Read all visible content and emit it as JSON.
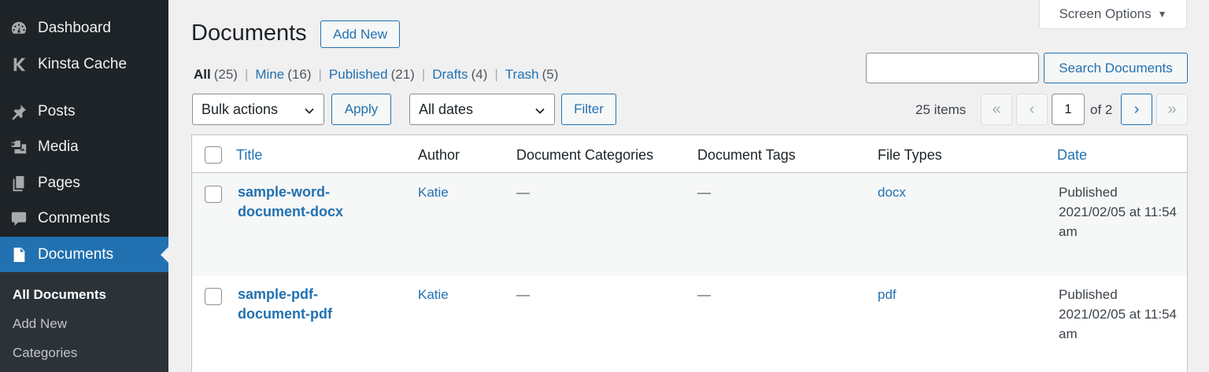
{
  "sidebar": {
    "items": [
      {
        "label": "Dashboard",
        "icon": "dashboard-icon"
      },
      {
        "label": "Kinsta Cache",
        "icon": "kinsta-icon"
      },
      {
        "label": "Posts",
        "icon": "pin-icon"
      },
      {
        "label": "Media",
        "icon": "media-icon"
      },
      {
        "label": "Pages",
        "icon": "pages-icon"
      },
      {
        "label": "Comments",
        "icon": "comments-icon"
      },
      {
        "label": "Documents",
        "icon": "document-icon"
      }
    ],
    "submenu": [
      "All Documents",
      "Add New",
      "Categories"
    ]
  },
  "header": {
    "title": "Documents",
    "add_new": "Add New",
    "screen_options": "Screen Options"
  },
  "filters": {
    "all": {
      "label": "All",
      "count": "(25)"
    },
    "mine": {
      "label": "Mine",
      "count": "(16)"
    },
    "published": {
      "label": "Published",
      "count": "(21)"
    },
    "drafts": {
      "label": "Drafts",
      "count": "(4)"
    },
    "trash": {
      "label": "Trash",
      "count": "(5)"
    },
    "separator": "|"
  },
  "search": {
    "value": "",
    "button": "Search Documents"
  },
  "bulk": {
    "selected": "Bulk actions",
    "apply": "Apply"
  },
  "dates": {
    "selected": "All dates",
    "filter": "Filter"
  },
  "pagination": {
    "items": "25 items",
    "first": "«",
    "prev": "‹",
    "current": "1",
    "of": "of 2",
    "next": "›",
    "last": "»"
  },
  "table": {
    "columns": {
      "title": "Title",
      "author": "Author",
      "categories": "Document Categories",
      "tags": "Document Tags",
      "file_types": "File Types",
      "date": "Date"
    },
    "rows": [
      {
        "title": "sample-word-document-docx",
        "author": "Katie",
        "categories": "—",
        "tags": "—",
        "file_type": "docx",
        "date": "Published 2021/02/05 at 11:54 am"
      },
      {
        "title": "sample-pdf-document-pdf",
        "author": "Katie",
        "categories": "—",
        "tags": "—",
        "file_type": "pdf",
        "date": "Published 2021/02/05 at 11:54 am"
      }
    ]
  }
}
